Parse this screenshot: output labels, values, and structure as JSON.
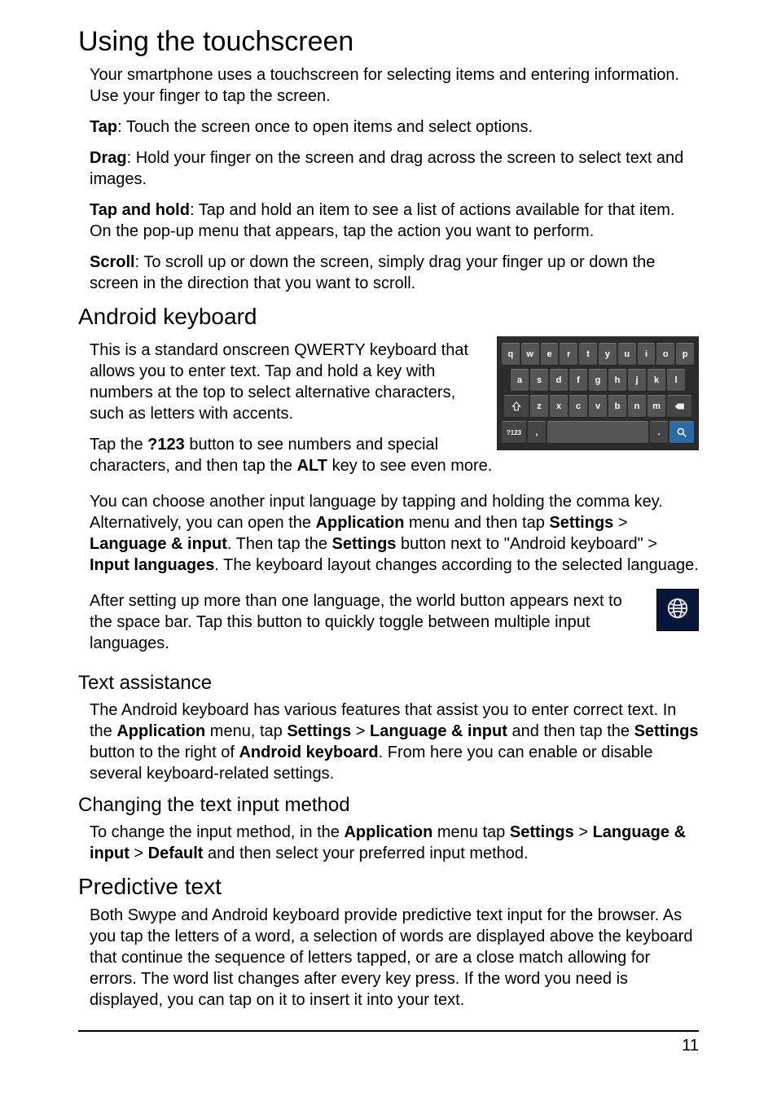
{
  "page_number": "11",
  "h1": "Using the touchscreen",
  "intro": "Your smartphone uses a touchscreen for selecting items and entering information. Use your finger to tap the screen.",
  "tap": {
    "label": "Tap",
    "text": ": Touch the screen once to open items and select options."
  },
  "drag": {
    "label": "Drag",
    "text": ": Hold your finger on the screen and drag across the screen to select text and images."
  },
  "taphold": {
    "label": "Tap and hold",
    "text": ": Tap and hold an item to see a list of actions available for that item. On the pop-up menu that appears, tap the action you want to perform."
  },
  "scroll": {
    "label": "Scroll",
    "text": ": To scroll up or down the screen, simply drag your finger up or down the screen in the direction that you want to scroll."
  },
  "h2_keyboard": "Android keyboard",
  "kb_p1": "This is a standard onscreen QWERTY keyboard that allows you to enter text. Tap and hold a key with numbers at the top to select alternative characters, such as letters with accents.",
  "kb_p2": {
    "pre": "Tap the ",
    "b1": "?123",
    "mid": " button to see numbers and special characters, and then tap the ",
    "b2": "ALT",
    "post": " key to see even more."
  },
  "kb_p3": {
    "pre": "You can choose another input language by tapping and holding the comma key. Alternatively, you can open the ",
    "b1": "Application",
    "t1": " menu and then tap ",
    "b2": "Settings",
    "t2": " > ",
    "b3": "Language & input",
    "t3": ". Then tap the ",
    "b4": "Settings",
    "t4": " button next to \"Android keyboard\" > ",
    "b5": "Input languages",
    "t5": ". The keyboard layout changes according to the selected language."
  },
  "kb_p4": "After setting up more than one language, the world button appears next to the space bar. Tap this button to quickly toggle between multiple input languages.",
  "h3_text_assist": "Text assistance",
  "ta_p": {
    "pre": "The Android keyboard has various features that assist you to enter correct text. In the ",
    "b1": "Application",
    "t1": " menu, tap ",
    "b2": "Settings",
    "t2": " > ",
    "b3": "Language & input",
    "t3": " and then tap the ",
    "b4": "Settings",
    "t4": " button to the right of ",
    "b5": "Android keyboard",
    "t5": ". From here you can enable or disable several keyboard-related settings."
  },
  "h3_change": "Changing the text input method",
  "ch_p": {
    "pre": "To change the input method, in the ",
    "b1": "Application",
    "t1": " menu tap ",
    "b2": "Settings",
    "t2": " > ",
    "b3": "Language & input",
    "t3": " > ",
    "b4": "Default",
    "t4": " and then select your preferred input method."
  },
  "h2_predictive": "Predictive text",
  "pred_p": "Both Swype and Android keyboard provide predictive text input for the browser. As you tap the letters of a word, a selection of words are displayed above the keyboard that continue the sequence of letters tapped, or are a close match allowing for errors. The word list changes after every key press. If the word you need is displayed, you can tap on it to insert it into your text.",
  "keyboard": {
    "row1": [
      "q",
      "w",
      "e",
      "r",
      "t",
      "y",
      "u",
      "i",
      "o",
      "p"
    ],
    "row2": [
      "a",
      "s",
      "d",
      "f",
      "g",
      "h",
      "j",
      "k",
      "l"
    ],
    "row3": [
      "z",
      "x",
      "c",
      "v",
      "b",
      "n",
      "m"
    ],
    "sym": "?123",
    "comma": ",",
    "period": "."
  }
}
